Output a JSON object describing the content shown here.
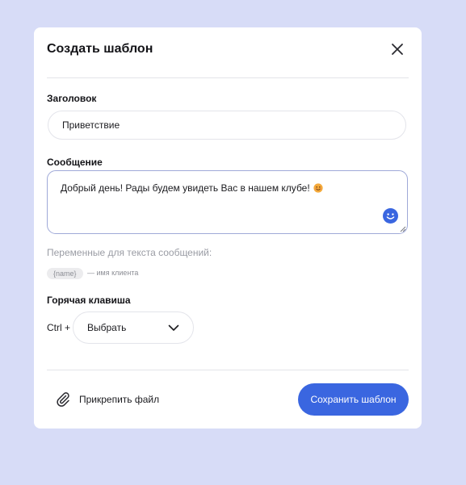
{
  "modal": {
    "title": "Создать шаблон"
  },
  "fields": {
    "title_label": "Заголовок",
    "title_value": "Приветствие",
    "message_label": "Сообщение",
    "message_value": "Добрый день! Рады будем увидеть Вас в нашем клубе!"
  },
  "variables": {
    "caption": "Переменные для текста сообщений:",
    "items": [
      {
        "token": "{name}",
        "description": "— имя клиента"
      }
    ]
  },
  "hotkey": {
    "label": "Горячая клавиша",
    "prefix": "Ctrl +",
    "select_value": "Выбрать"
  },
  "footer": {
    "attach_label": "Прикрепить файл",
    "save_label": "Сохранить шаблон"
  },
  "colors": {
    "background": "#d7dcf7",
    "accent": "#3a66e0",
    "emoji_button": "#3a66e0"
  },
  "icons": {
    "close": "close-icon",
    "emoji": "smiley-emoji-icon",
    "chevron": "chevron-down-icon",
    "attach": "paperclip-icon"
  }
}
